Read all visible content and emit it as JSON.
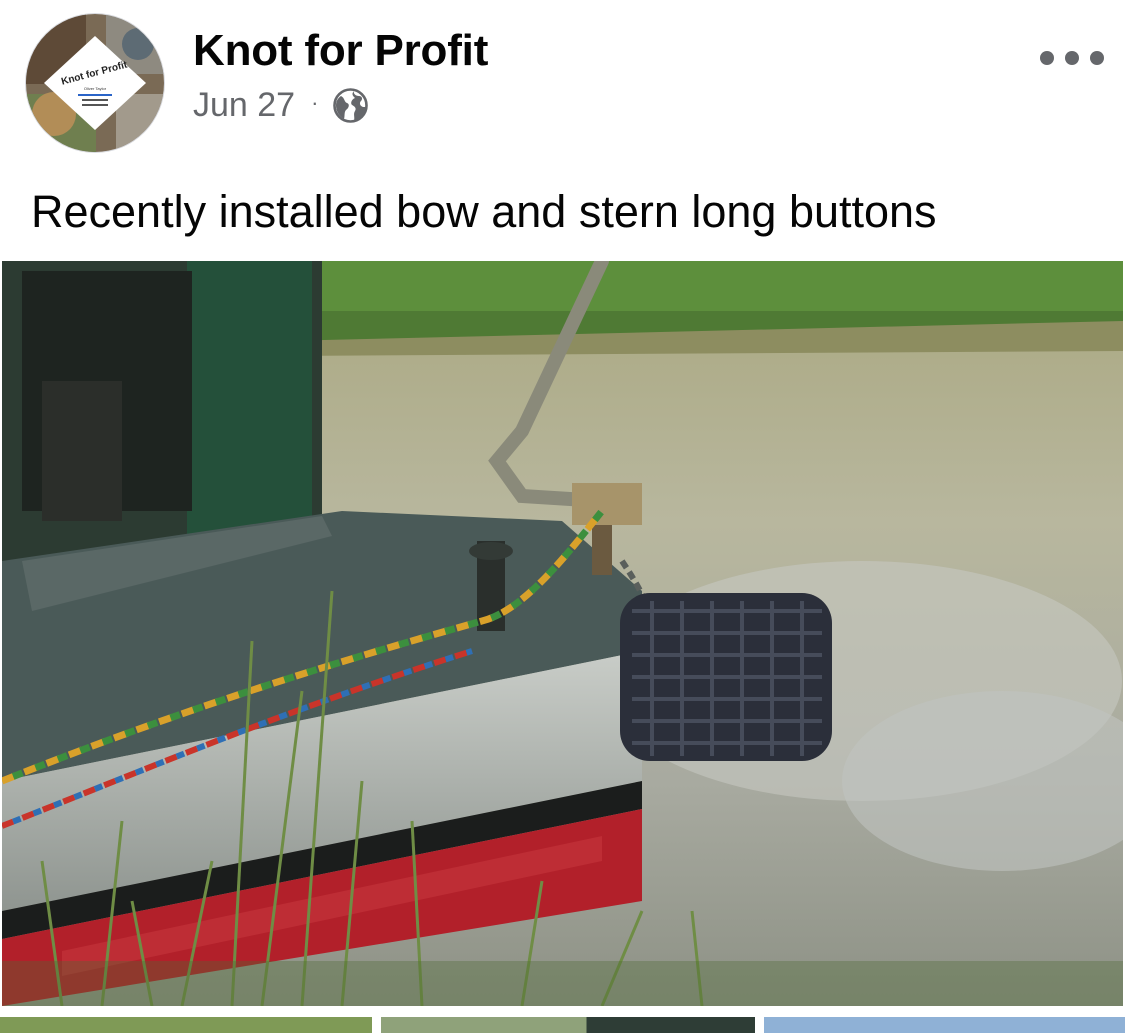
{
  "post": {
    "page_name": "Knot for Profit",
    "date": "Jun 27",
    "separator": "·",
    "privacy_icon": "globe-icon",
    "more_icon": "more-options-icon",
    "caption": "Recently installed bow and stern long buttons"
  },
  "avatar": {
    "logo_text": "Knot for Profit",
    "logo_subtext": "Oliver Taylor"
  },
  "colors": {
    "text_primary": "#050505",
    "text_secondary": "#65676b",
    "background": "#ffffff"
  }
}
